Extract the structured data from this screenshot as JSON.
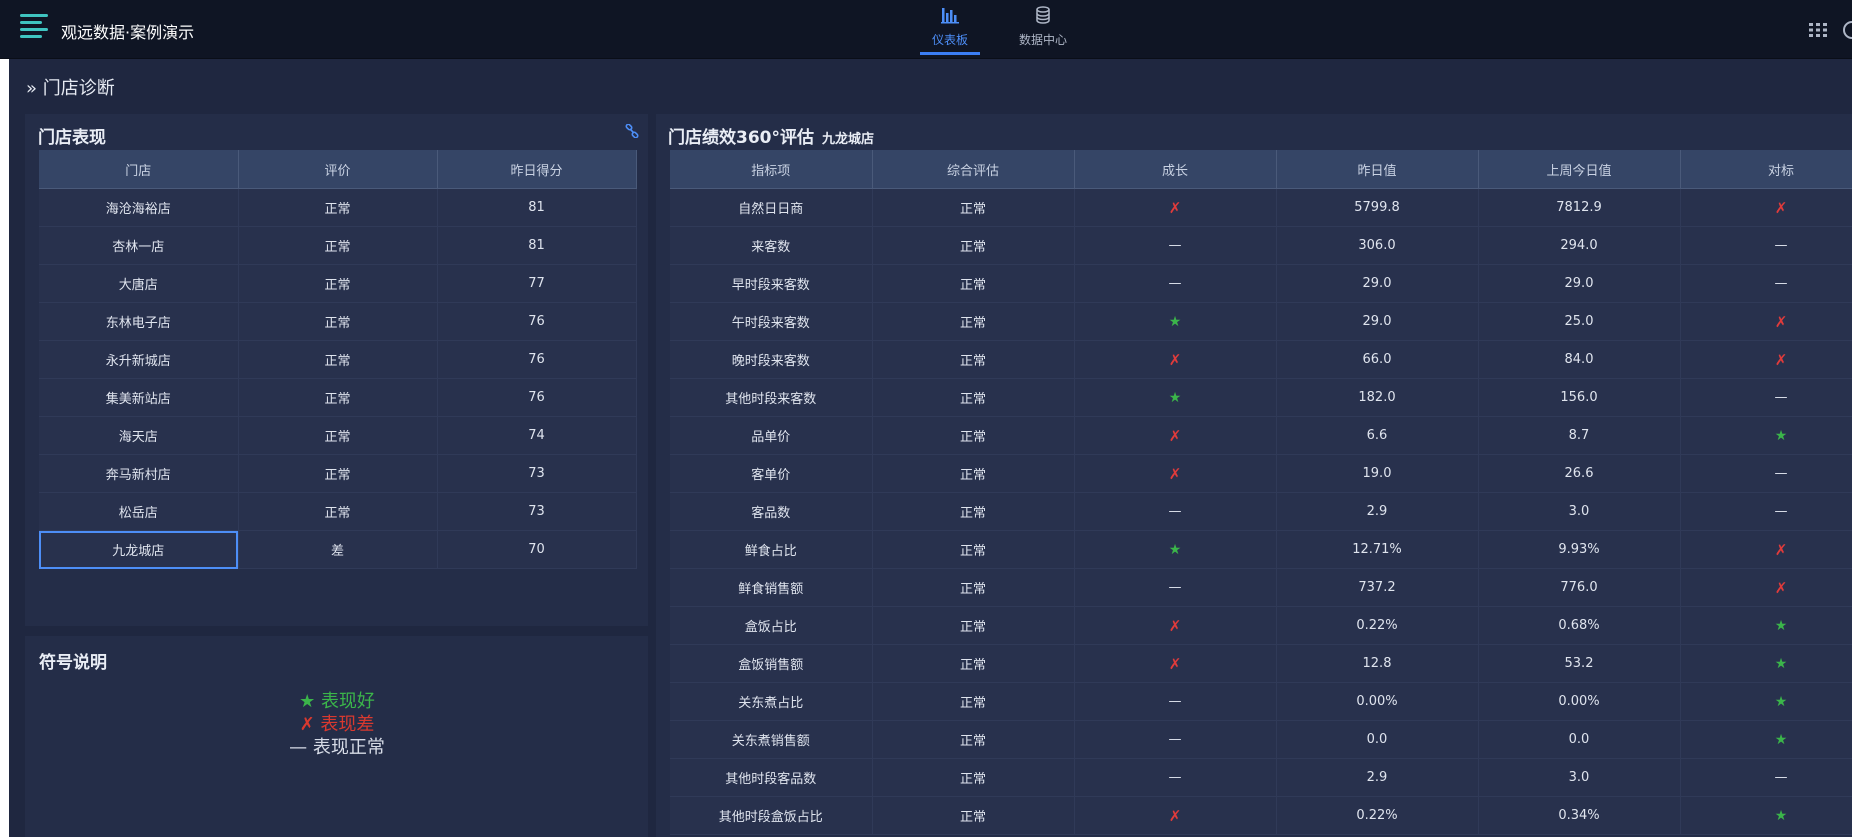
{
  "header": {
    "app_title": "观远数据·案例演示",
    "nav": [
      {
        "label": "仪表板",
        "icon": "bar-chart-icon",
        "active": true
      },
      {
        "label": "数据中心",
        "icon": "database-icon",
        "active": false
      }
    ]
  },
  "breadcrumb": "» 门店诊断",
  "store_panel": {
    "title": "门店表现",
    "columns": [
      "门店",
      "评价",
      "昨日得分"
    ],
    "rows": [
      [
        "海沧海裕店",
        "正常",
        "81"
      ],
      [
        "杏林一店",
        "正常",
        "81"
      ],
      [
        "大唐店",
        "正常",
        "77"
      ],
      [
        "东林电子店",
        "正常",
        "76"
      ],
      [
        "永升新城店",
        "正常",
        "76"
      ],
      [
        "集美新站店",
        "正常",
        "76"
      ],
      [
        "海天店",
        "正常",
        "74"
      ],
      [
        "奔马新村店",
        "正常",
        "73"
      ],
      [
        "松岳店",
        "正常",
        "73"
      ],
      [
        "九龙城店",
        "差",
        "70"
      ]
    ]
  },
  "legend_panel": {
    "title": "符号说明",
    "items": [
      {
        "symbol": "★",
        "text": "表现好"
      },
      {
        "symbol": "✗",
        "text": "表现差"
      },
      {
        "symbol": "—",
        "text": "表现正常"
      }
    ]
  },
  "eval_panel": {
    "title": "门店绩效360°评估",
    "subtitle": "九龙城店",
    "columns": [
      "指标项",
      "综合评估",
      "成长",
      "昨日值",
      "上周今日值",
      "对标"
    ],
    "rows": [
      [
        "自然日日商",
        "正常",
        "✗",
        "5799.8",
        "7812.9",
        "✗"
      ],
      [
        "来客数",
        "正常",
        "—",
        "306.0",
        "294.0",
        "—"
      ],
      [
        "早时段来客数",
        "正常",
        "—",
        "29.0",
        "29.0",
        "—"
      ],
      [
        "午时段来客数",
        "正常",
        "★",
        "29.0",
        "25.0",
        "✗"
      ],
      [
        "晚时段来客数",
        "正常",
        "✗",
        "66.0",
        "84.0",
        "✗"
      ],
      [
        "其他时段来客数",
        "正常",
        "★",
        "182.0",
        "156.0",
        "—"
      ],
      [
        "品单价",
        "正常",
        "✗",
        "6.6",
        "8.7",
        "★"
      ],
      [
        "客单价",
        "正常",
        "✗",
        "19.0",
        "26.6",
        "—"
      ],
      [
        "客品数",
        "正常",
        "—",
        "2.9",
        "3.0",
        "—"
      ],
      [
        "鲜食占比",
        "正常",
        "★",
        "12.71%",
        "9.93%",
        "✗"
      ],
      [
        "鲜食销售额",
        "正常",
        "—",
        "737.2",
        "776.0",
        "✗"
      ],
      [
        "盒饭占比",
        "正常",
        "✗",
        "0.22%",
        "0.68%",
        "★"
      ],
      [
        "盒饭销售额",
        "正常",
        "✗",
        "12.8",
        "53.2",
        "★"
      ],
      [
        "关东煮占比",
        "正常",
        "—",
        "0.00%",
        "0.00%",
        "★"
      ],
      [
        "关东煮销售额",
        "正常",
        "—",
        "0.0",
        "0.0",
        "★"
      ],
      [
        "其他时段客品数",
        "正常",
        "—",
        "2.9",
        "3.0",
        "—"
      ],
      [
        "其他时段盒饭占比",
        "正常",
        "✗",
        "0.22%",
        "0.34%",
        "★"
      ]
    ]
  },
  "colors": {
    "good": "#3bb54a",
    "bad": "#e03b3b",
    "accent": "#4d8ef7",
    "poor_cell": "#c8312a"
  }
}
